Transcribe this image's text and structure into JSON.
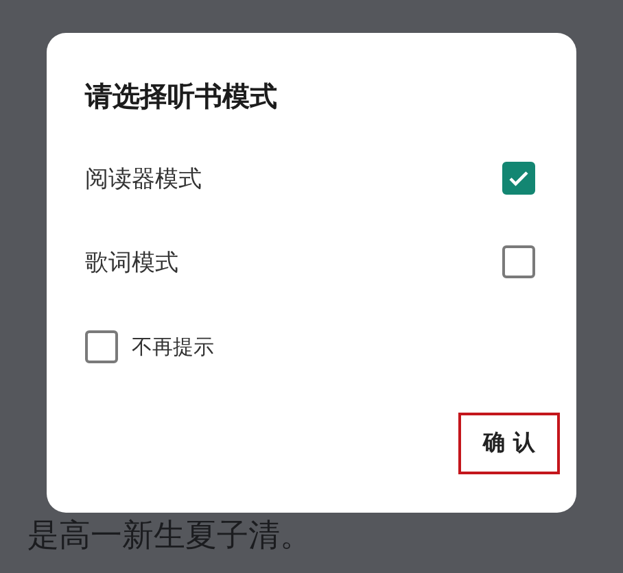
{
  "background_text": {
    "lines": [
      "是高一新生夏子清。"
    ]
  },
  "dialog": {
    "title": "请选择听书模式",
    "options": [
      {
        "label": "阅读器模式",
        "selected": true
      },
      {
        "label": "歌词模式",
        "selected": false
      }
    ],
    "dont_remind": {
      "label": "不再提示",
      "checked": false
    },
    "confirm_button": {
      "label": "确 认",
      "highlighted": true
    }
  }
}
